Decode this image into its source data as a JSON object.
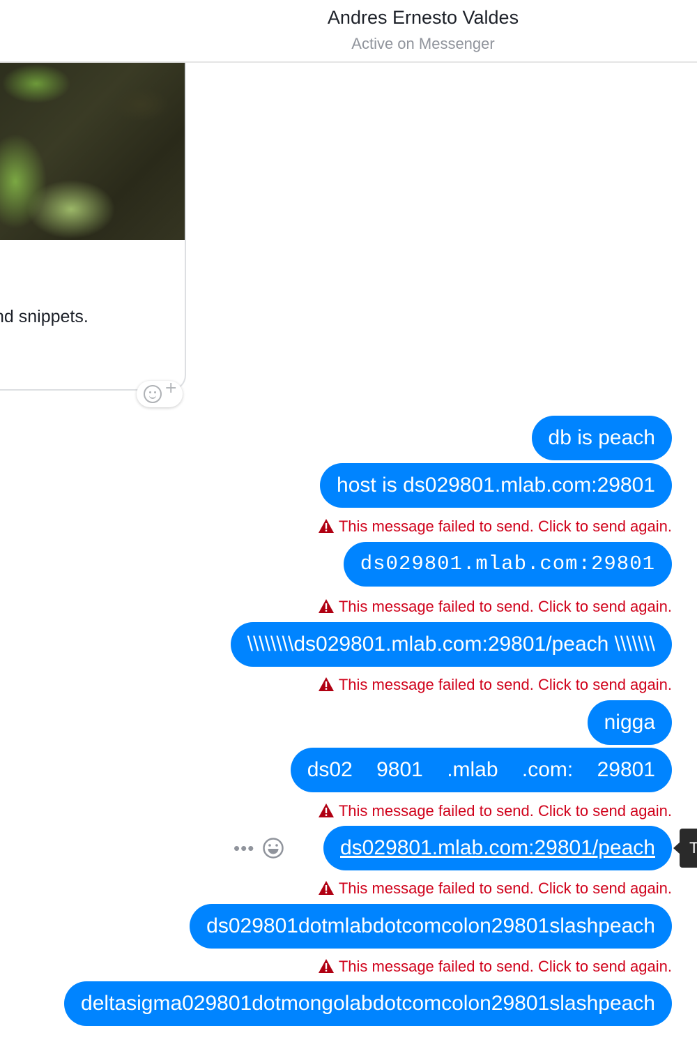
{
  "header": {
    "title": "Andres Ernesto Valdes",
    "subtitle": "Active on Messenger"
  },
  "shared_card": {
    "snippet": "nd snippets."
  },
  "messages": [
    {
      "text": "db is peach",
      "failed": false
    },
    {
      "text": "host is ds029801.mlab.com:29801",
      "failed": true
    },
    {
      "text": "ds029801.mlab.com:29801",
      "failed": true
    },
    {
      "text": "\\\\\\\\\\\\\\\\ds029801.mlab.com:29801/peach \\\\\\\\\\\\\\",
      "failed": true
    },
    {
      "text": "nigga",
      "failed": false
    },
    {
      "text": "ds02  9801  .mlab   .com:  29801",
      "failed": true
    },
    {
      "text": "ds029801.mlab.com:29801/peach",
      "failed": true
    },
    {
      "text": "ds029801dotmlabdotcomcolon29801slashpeach",
      "failed": true
    },
    {
      "text": "deltasigma029801dotmongolabdotcomcolon29801slashpeach",
      "failed": false
    }
  ],
  "fail_notice": "This message failed to send. Click to send again.",
  "more_label": "•••",
  "tooltip": "T",
  "colors": {
    "bubble": "#0084ff",
    "error": "#d0021b"
  },
  "icons": {
    "add_reaction": "smiley-plus-icon",
    "warning": "warning-triangle-icon",
    "more": "more-options-icon",
    "react": "smiley-icon"
  }
}
